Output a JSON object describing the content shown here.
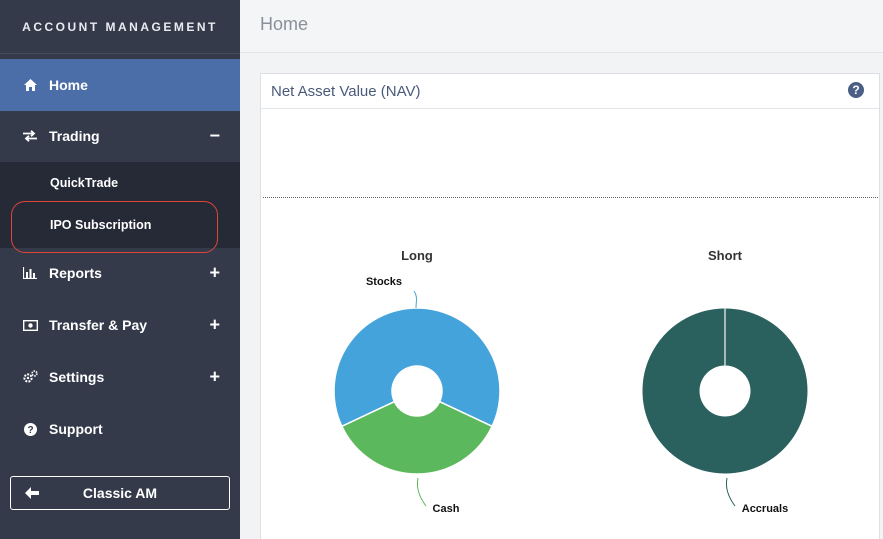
{
  "sidebar": {
    "brand": "ACCOUNT MANAGEMENT",
    "items": {
      "home": {
        "label": "Home",
        "icon": "home-icon"
      },
      "trading": {
        "label": "Trading",
        "icon": "transfer-arrows-icon",
        "toggle": "−"
      },
      "reports": {
        "label": "Reports",
        "icon": "bar-chart-icon",
        "toggle": "+"
      },
      "transfer": {
        "label": "Transfer & Pay",
        "icon": "money-icon",
        "toggle": "+"
      },
      "settings": {
        "label": "Settings",
        "icon": "gears-icon",
        "toggle": "+"
      },
      "support": {
        "label": "Support",
        "icon": "question-circle-icon"
      }
    },
    "submenu": {
      "quicktrade": "QuickTrade",
      "ipo": "IPO Subscription"
    },
    "classic_button": {
      "label": "Classic AM",
      "icon": "arrow-left-icon"
    }
  },
  "header": {
    "title": "Home"
  },
  "panel": {
    "title": "Net Asset Value (NAV)",
    "help_icon": "?"
  },
  "colors": {
    "sidebar_bg": "#343a4a",
    "active_item": "#4c6ea8",
    "submenu_bg": "#262a37",
    "highlight_ring": "#e0453a",
    "stocks": "#45a3dc",
    "cash": "#5cb85c",
    "accruals": "#2a605d"
  },
  "chart_data": [
    {
      "type": "pie",
      "title": "Long",
      "labels": [
        "Stocks",
        "Cash"
      ],
      "values": [
        64,
        36
      ],
      "colors": [
        "#45a3dc",
        "#5cb85c"
      ]
    },
    {
      "type": "pie",
      "title": "Short",
      "labels": [
        "Accruals"
      ],
      "values": [
        100
      ],
      "colors": [
        "#2a605d"
      ]
    }
  ]
}
